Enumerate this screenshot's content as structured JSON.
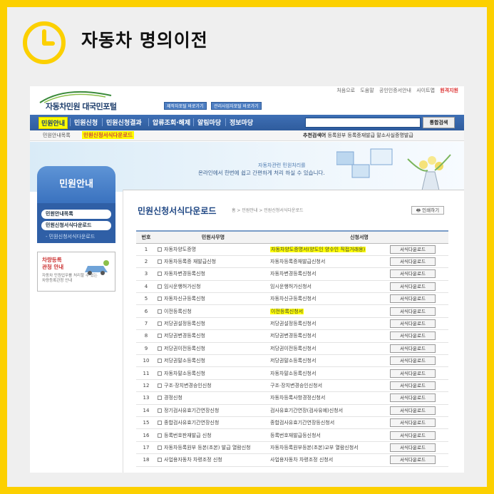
{
  "headline": "자동차 명의이전",
  "site": {
    "logo_text": "자동차민원 대국민포털",
    "mini_buttons": [
      "제작자포털 바로가기",
      "관리사업자포털 바로가기"
    ],
    "top_links": [
      "처음으로",
      "도움말",
      "공인인증서안내",
      "사이트맵",
      "원격지원"
    ]
  },
  "nav": {
    "items": [
      "민원안내",
      "민원신청",
      "민원신청결과",
      "압류조회·해제",
      "알림마당",
      "정보마당"
    ],
    "search_button": "통합검색"
  },
  "subnav": {
    "item1": "민원안내목록",
    "item2": "민원신청서식다운로드",
    "recommend_label": "추천검색어",
    "recommend_words": "등록원부  등록증재발급  말소사실증명발급"
  },
  "banner": {
    "line1": "자동차관련 민원처리를",
    "line2": "온라인에서 한번에 쉽고 간편하게 처리 하실 수 있습니다."
  },
  "left": {
    "title": "민원안내",
    "menu": [
      "민원안내목록",
      "민원신청서식다운로드"
    ],
    "sub": "- 민원신청서식다운로드",
    "box_title": "차량등록\n관청 안내",
    "box_desc": "자동차 민원업무를 처리할 수 있는\n차량등록관청 안내"
  },
  "content": {
    "title": "민원신청서식다운로드",
    "path": "홈 > 민원안내 > 민원신청서식다운로드",
    "print": "인쇄하기",
    "headers": [
      "번호",
      "민원사무명",
      "신청서명"
    ],
    "download_label": "서식다운로드",
    "rows": [
      {
        "no": "1",
        "name": "자동차양도증명",
        "form": "자동차양도증명서(양도인 양수인 직접거래용)",
        "hl": true
      },
      {
        "no": "2",
        "name": "자동차등록증 재발급신청",
        "form": "자동차등록증재발급신청서",
        "hl": false
      },
      {
        "no": "3",
        "name": "자동차변경등록신청",
        "form": "자동차변경등록신청서",
        "hl": false
      },
      {
        "no": "4",
        "name": "임시운행허가신청",
        "form": "임시운행허가신청서",
        "hl": false
      },
      {
        "no": "5",
        "name": "자동차신규등록신청",
        "form": "자동차신규등록신청서",
        "hl": false
      },
      {
        "no": "6",
        "name": "이전등록신청",
        "form": "이전등록신청서",
        "hl": true
      },
      {
        "no": "7",
        "name": "저당권설정등록신청",
        "form": "저당권설정등록신청서",
        "hl": false
      },
      {
        "no": "8",
        "name": "저당권변경등록신청",
        "form": "저당권변경등록신청서",
        "hl": false
      },
      {
        "no": "9",
        "name": "저당권이전등록신청",
        "form": "저당권이전등록신청서",
        "hl": false
      },
      {
        "no": "10",
        "name": "저당권말소등록신청",
        "form": "저당권말소등록신청서",
        "hl": false
      },
      {
        "no": "11",
        "name": "자동차말소등록신청",
        "form": "자동차말소등록신청서",
        "hl": false
      },
      {
        "no": "12",
        "name": "구조·장치변경승인신청",
        "form": "구조·장치변경승인신청서",
        "hl": false
      },
      {
        "no": "13",
        "name": "경정신청",
        "form": "자동차등록사항경정신청서",
        "hl": false
      },
      {
        "no": "14",
        "name": "정기검사유효기간연장신청",
        "form": "검사유효기간연장(검사유예)신청서",
        "hl": false
      },
      {
        "no": "15",
        "name": "종합검사유효기간연장신청",
        "form": "종합검사유효기간연장등신청서",
        "hl": false
      },
      {
        "no": "16",
        "name": "등록번호판재발급 신청",
        "form": "등록번호재발급등신청서",
        "hl": false
      },
      {
        "no": "17",
        "name": "자동차등록원부 등본(초본) 발급 열람신청",
        "form": "자동차등록원부등본(초본)교부 열람신청서",
        "hl": false
      },
      {
        "no": "18",
        "name": "사업용자동차 차령조정 신청",
        "form": "사업용자동차 차령조정 신청서",
        "hl": false
      }
    ]
  }
}
